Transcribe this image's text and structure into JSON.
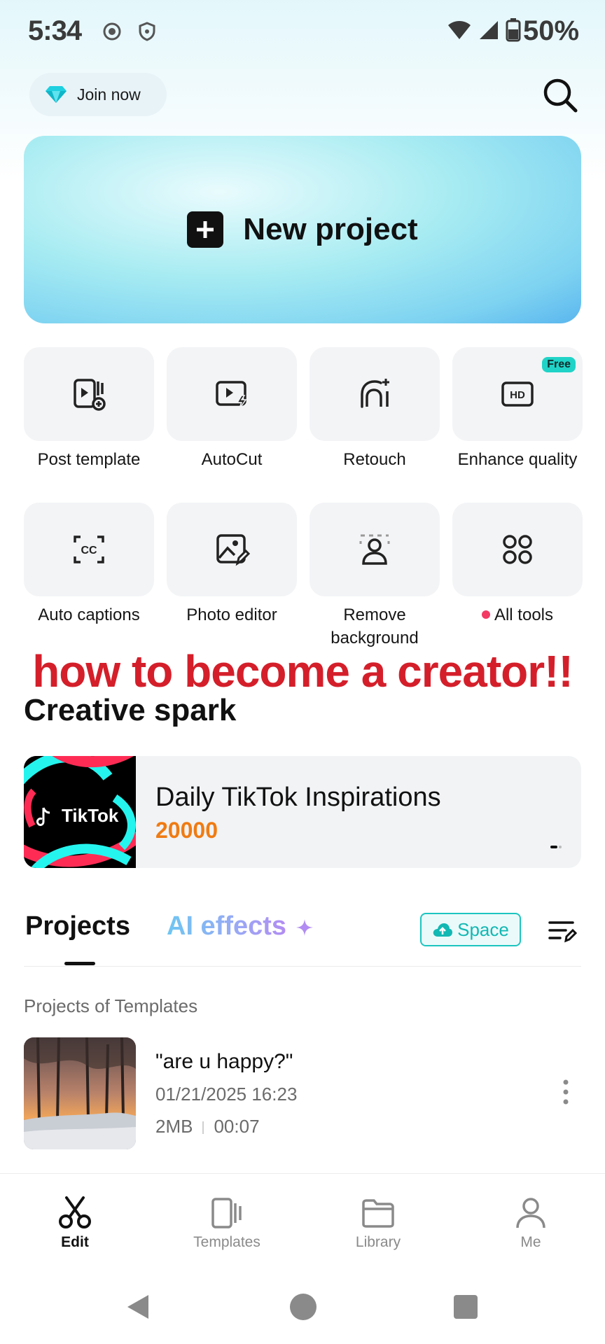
{
  "status_bar": {
    "time": "5:34",
    "battery": "50%"
  },
  "header": {
    "join_label": "Join now"
  },
  "new_project": {
    "label": "New project"
  },
  "tools": [
    {
      "name": "Post template"
    },
    {
      "name": "AutoCut"
    },
    {
      "name": "Retouch"
    },
    {
      "name": "Enhance quality",
      "badge": "Free"
    },
    {
      "name": "Auto captions"
    },
    {
      "name": "Photo editor"
    },
    {
      "name": "Remove background"
    },
    {
      "name": "All tools"
    }
  ],
  "overlay_caption": "how to become a creator!!",
  "creative_spark": {
    "heading": "Creative spark",
    "card_title": "Daily TikTok Inspirations",
    "card_count": "20000",
    "thumb_brand": "TikTok"
  },
  "tabs": {
    "projects": "Projects",
    "ai_effects": "AI effects",
    "space": "Space"
  },
  "projects_section": {
    "label": "Projects of Templates",
    "items": [
      {
        "title": "\"are u happy?\"",
        "date": "01/21/2025 16:23",
        "size": "2MB",
        "duration": "00:07"
      }
    ]
  },
  "bottom_nav": [
    {
      "label": "Edit"
    },
    {
      "label": "Templates"
    },
    {
      "label": "Library"
    },
    {
      "label": "Me"
    }
  ],
  "colors": {
    "accent_teal": "#1cc5c0",
    "spark_count": "#f07b12",
    "overlay_red": "#d41f2a",
    "alert_dot": "#f23a65"
  }
}
